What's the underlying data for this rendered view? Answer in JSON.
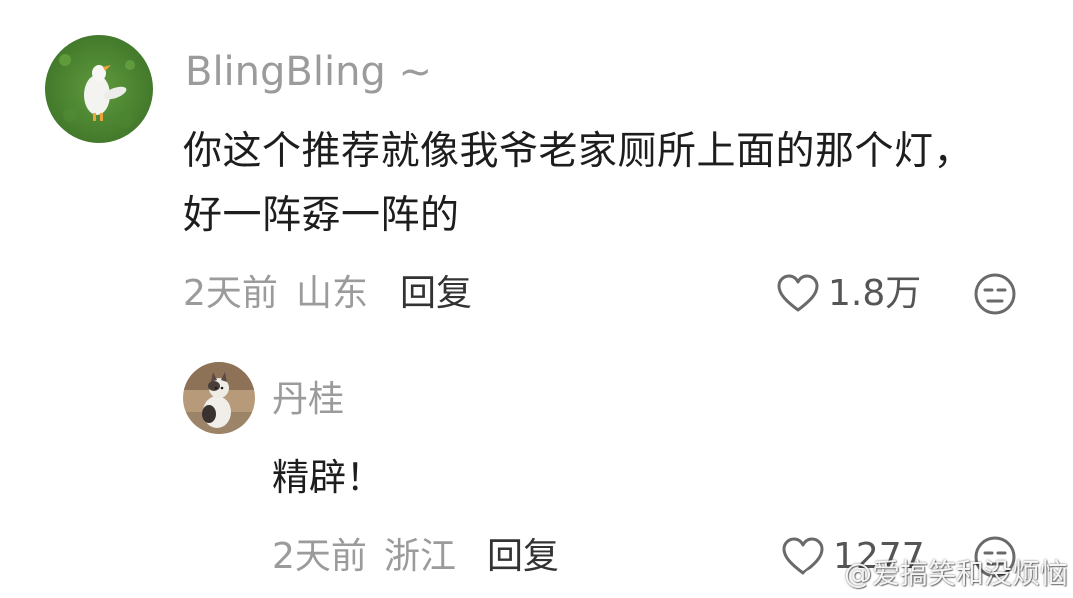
{
  "comments": [
    {
      "username": "BlingBling ~",
      "text_lines": [
        "你这个推荐就像我爷老家厕所上面的那个灯，",
        "好一阵孬一阵的"
      ],
      "time": "2天前",
      "location": "山东",
      "reply_label": "回复",
      "likes": "1.8万",
      "avatar": "duck-on-grass"
    },
    {
      "username": "丹桂",
      "text_lines": [
        "精辟！"
      ],
      "time": "2天前",
      "location": "浙江",
      "reply_label": "回复",
      "likes": "1277",
      "avatar": "cat-photo"
    }
  ],
  "icons": {
    "like": "heart-outline-icon",
    "dislike": "unamused-face-icon",
    "watermark_logo": "weibo-logo-icon"
  },
  "watermark": {
    "text": "@爱搞笑和没烦恼"
  },
  "colors": {
    "username": "#9b9b9b",
    "body": "#1d1d1d",
    "meta": "#9b9b9b",
    "reply": "#333333",
    "icon": "#6a6a6a"
  }
}
